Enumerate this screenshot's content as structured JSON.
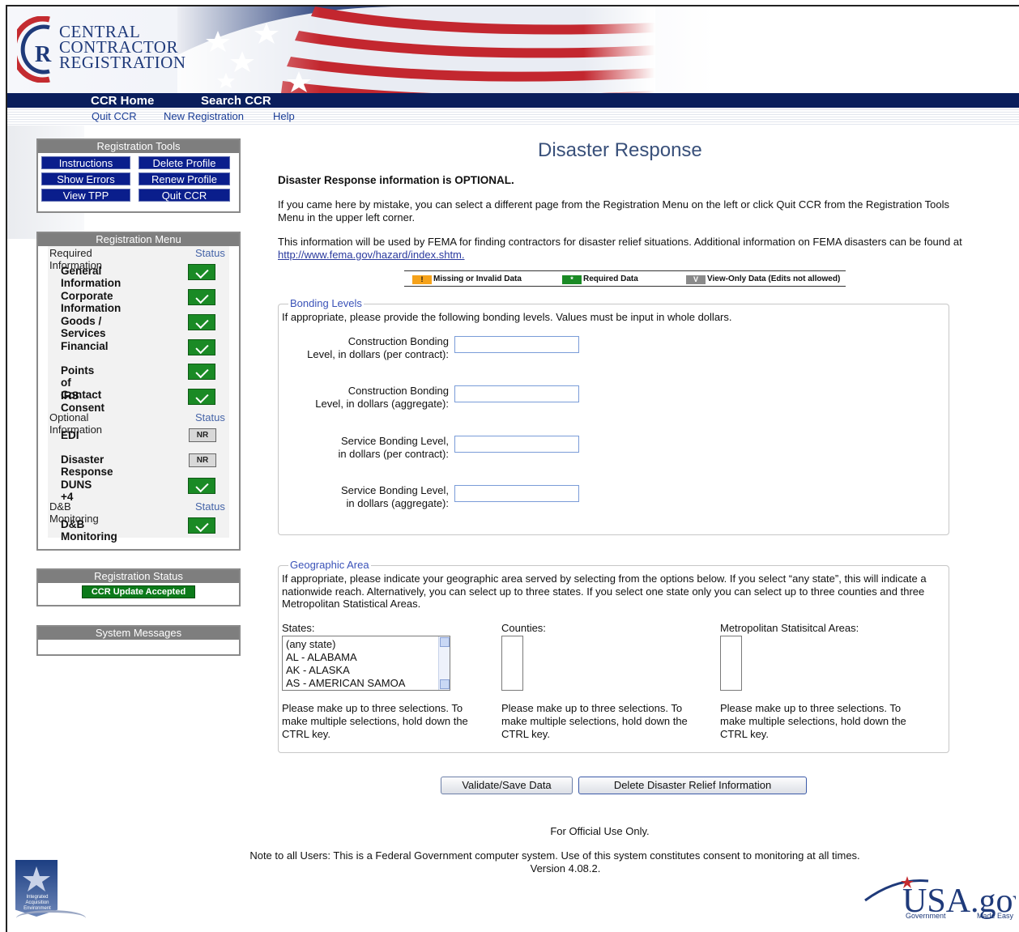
{
  "brand": {
    "line1": "CENTRAL",
    "line2": "CONTRACTOR",
    "line3": "REGISTRATION"
  },
  "nav": {
    "home": "CCR Home",
    "search": "Search CCR",
    "quit": "Quit CCR",
    "new_registration": "New Registration",
    "help": "Help"
  },
  "tools": {
    "title": "Registration Tools",
    "instructions": "Instructions",
    "delete_profile": "Delete Profile",
    "show_errors": "Show Errors",
    "renew_profile": "Renew Profile",
    "view_tpp": "View TPP",
    "quit_ccr": "Quit CCR"
  },
  "menu": {
    "title": "Registration Menu",
    "status_label": "Status",
    "required_label": "Required Information",
    "optional_label": "Optional Information",
    "dnb_label": "D&B Monitoring",
    "items": [
      {
        "label": "General Information",
        "status": "check"
      },
      {
        "label": "Corporate Information",
        "status": "check"
      },
      {
        "label": "Goods / Services",
        "status": "check"
      },
      {
        "label": "Financial",
        "status": "check"
      },
      {
        "label": "Points of Contact",
        "status": "check"
      },
      {
        "label": "IRS Consent",
        "status": "check"
      },
      {
        "label": "EDI",
        "status": "NR"
      },
      {
        "label": "Disaster Response",
        "status": "NR"
      },
      {
        "label": "DUNS +4",
        "status": "check"
      },
      {
        "label": "D&B Monitoring",
        "status": "check"
      }
    ]
  },
  "reg_status": {
    "title": "Registration Status",
    "value": "CCR Update Accepted"
  },
  "system_messages": {
    "title": "System Messages"
  },
  "main": {
    "title": "Disaster Response",
    "optional": "Disaster Response information is OPTIONAL.",
    "p1": "If you came here by mistake, you can select a different page from the Registration Menu on the left or click Quit CCR from the Registration Tools Menu in the upper left corner.",
    "p2": "This information will be used by FEMA for finding contractors for disaster relief situations. Additional information on FEMA disasters can be found at ",
    "p2_link": "http://www.fema.gov/hazard/index.shtm.",
    "legend": {
      "missing": "Missing or Invalid Data",
      "required": "Required Data",
      "viewonly": "View-Only Data (Edits not allowed)",
      "missing_sym": "!",
      "required_sym": "*",
      "viewonly_sym": "V"
    }
  },
  "bonding": {
    "legend": "Bonding Levels",
    "desc": "If appropriate, please provide the following bonding levels. Values must be input in whole dollars.",
    "f1a": "Construction Bonding",
    "f1b": "Level, in dollars (per contract):",
    "f2a": "Construction Bonding",
    "f2b": "Level, in dollars (aggregate):",
    "f3a": "Service Bonding Level,",
    "f3b": "in dollars (per contract):",
    "f4a": "Service Bonding Level,",
    "f4b": "in dollars (aggregate):"
  },
  "geo": {
    "legend": "Geographic Area",
    "desc": "If appropriate, please indicate your geographic area served by selecting from the options below. If you select “any state”, this will indicate a nationwide reach. Alternatively, you can select up to three states. If you select one state only you can select up to three counties and three Metropolitan Statistical Areas.",
    "states_label": "States:",
    "counties_label": "Counties:",
    "msa_label": "Metropolitan Statisitcal Areas:",
    "states": [
      "(any state)",
      "AL - ALABAMA",
      "AK - ALASKA",
      "AS - AMERICAN SAMOA"
    ],
    "hint": "Please make up to three selections. To make multiple selections, hold down the CTRL key."
  },
  "buttons": {
    "validate": "Validate/Save Data",
    "delete": "Delete Disaster Relief Information"
  },
  "footer": {
    "official": "For Official Use Only.",
    "note": "Note to all Users: This is a Federal Government computer system. Use of this system constitutes consent to monitoring at all times.",
    "version": "Version 4.08.2.",
    "iae": "Integrated Acquisition Environment",
    "usa_main": "USA.gov",
    "usa_sub1": "Government",
    "usa_sub2": "Made Easy"
  }
}
